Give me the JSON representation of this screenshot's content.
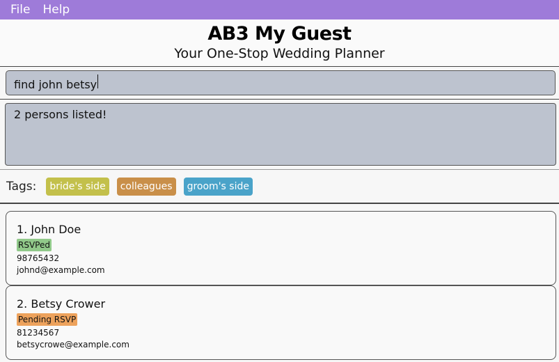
{
  "menu": {
    "file": "File",
    "help": "Help"
  },
  "header": {
    "title": "AB3 My Guest",
    "subtitle": "Your One-Stop Wedding Planner"
  },
  "command": {
    "value": "find john betsy"
  },
  "result": {
    "message": "2 persons listed!"
  },
  "tags": {
    "label": "Tags:",
    "items": [
      {
        "label": "bride's side",
        "color": "#c3c04b"
      },
      {
        "label": "colleagues",
        "color": "#c98f49"
      },
      {
        "label": "groom's side",
        "color": "#4aa3c9"
      }
    ]
  },
  "persons": [
    {
      "name": "1. John Doe",
      "status": "RSVPed",
      "status_color": "#91c98a",
      "phone": "98765432",
      "email": "johnd@example.com"
    },
    {
      "name": "2. Betsy Crower",
      "status": "Pending RSVP",
      "status_color": "#eda25c",
      "phone": "81234567",
      "email": "betsycrowe@example.com"
    }
  ]
}
